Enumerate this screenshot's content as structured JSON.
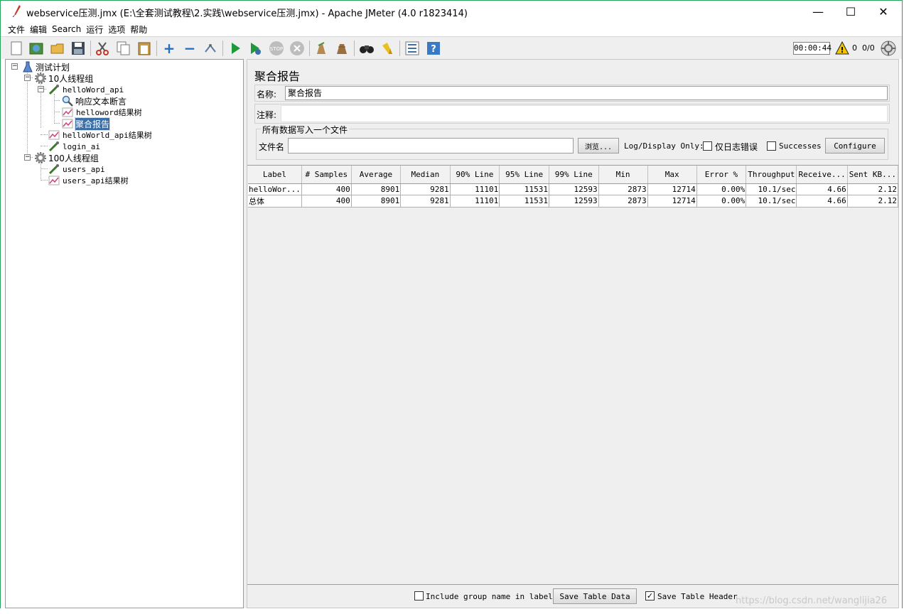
{
  "window": {
    "title": "webservice压测.jmx (E:\\全套测试教程\\2.实践\\webservice压测.jmx) - Apache JMeter (4.0 r1823414)",
    "minimize": "—",
    "maximize": "☐",
    "close": "✕"
  },
  "menu": [
    "文件",
    "编辑",
    "Search",
    "运行",
    "选项",
    "帮助"
  ],
  "toolbar": {
    "timer": "00:00:44",
    "warning_count": "0",
    "threads": "0/0"
  },
  "tree": {
    "root": "测试计划",
    "group1": "10人线程组",
    "sampler1": "helloWord_api",
    "assertion": "响应文本断言",
    "listener1": "helloword结果树",
    "listener2": "聚合报告",
    "listener3": "helloWorld_api结果树",
    "sampler2": "login_ai",
    "group2": "100人线程组",
    "sampler3": "users_api",
    "listener4": "users_api结果树"
  },
  "panel": {
    "title": "聚合报告",
    "name_label": "名称:",
    "name_value": "聚合报告",
    "comment_label": "注释:",
    "comment_value": "",
    "file_group_title": "所有数据写入一个文件",
    "filename_label": "文件名",
    "filename_value": "",
    "browse": "浏览...",
    "log_display": "Log/Display Only:",
    "errors_only": "仅日志错误",
    "successes": "Successes",
    "configure": "Configure"
  },
  "table": {
    "headers": [
      "Label",
      "# Samples",
      "Average",
      "Median",
      "90% Line",
      "95% Line",
      "99% Line",
      "Min",
      "Max",
      "Error %",
      "Throughput",
      "Receive...",
      "Sent KB..."
    ],
    "rows": [
      [
        "helloWor...",
        "400",
        "8901",
        "9281",
        "11101",
        "11531",
        "12593",
        "2873",
        "12714",
        "0.00%",
        "10.1/sec",
        "4.66",
        "2.12"
      ],
      [
        "总体",
        "400",
        "8901",
        "9281",
        "11101",
        "11531",
        "12593",
        "2873",
        "12714",
        "0.00%",
        "10.1/sec",
        "4.66",
        "2.12"
      ]
    ]
  },
  "bottom": {
    "include_group": "Include group name in label?",
    "save_data": "Save Table Data",
    "save_header": "Save Table Header"
  },
  "watermark": "https://blog.csdn.net/wanglijia26",
  "colors": {
    "selection": "#3a6ea5",
    "panel_bg": "#efefef",
    "frame": "#25a35a"
  }
}
